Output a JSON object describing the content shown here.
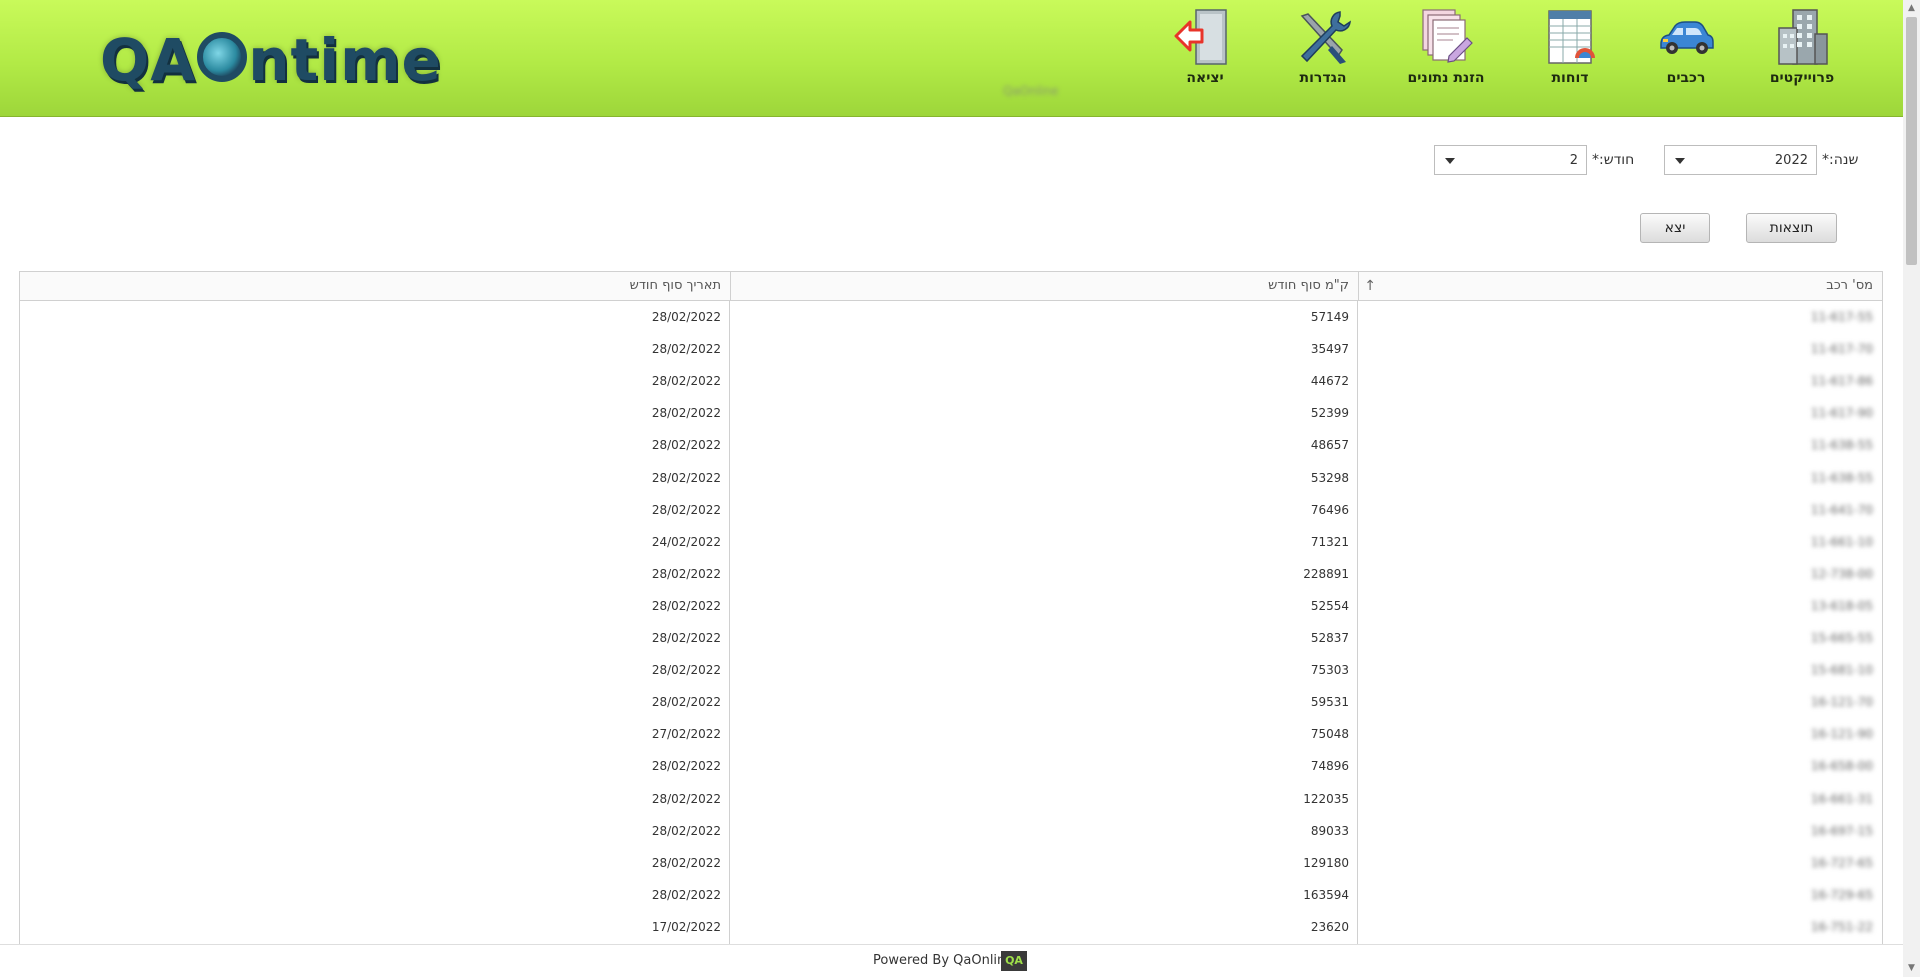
{
  "app": {
    "logo_text": [
      "QA",
      "ntime"
    ],
    "subtitle": "QaOnline"
  },
  "nav": {
    "projects": "פרוייקטים",
    "vehicles": "רכבים",
    "reports": "דוחות",
    "data_entry": "הזנת נתונים",
    "settings": "הגדרות",
    "logout": "יציאה"
  },
  "filters": {
    "year_label": "שנה:*",
    "year_value": "2022",
    "month_label": "חודש:*",
    "month_value": "2"
  },
  "buttons": {
    "results": "תוצאות",
    "export": "יצא"
  },
  "grid": {
    "columns": {
      "vehicle_no": "מס' רכב",
      "km_end": "ק\"מ סוף חודש",
      "date_end": "תאריך סוף חודש"
    },
    "sort_indicator": "↑",
    "rows": [
      {
        "vehicle": "11-617-55",
        "km": "57149",
        "date": "28/02/2022"
      },
      {
        "vehicle": "11-617-70",
        "km": "35497",
        "date": "28/02/2022"
      },
      {
        "vehicle": "11-617-86",
        "km": "44672",
        "date": "28/02/2022"
      },
      {
        "vehicle": "11-617-90",
        "km": "52399",
        "date": "28/02/2022"
      },
      {
        "vehicle": "11-638-55",
        "km": "48657",
        "date": "28/02/2022"
      },
      {
        "vehicle": "11-638-55",
        "km": "53298",
        "date": "28/02/2022"
      },
      {
        "vehicle": "11-641-70",
        "km": "76496",
        "date": "28/02/2022"
      },
      {
        "vehicle": "11-661-10",
        "km": "71321",
        "date": "24/02/2022"
      },
      {
        "vehicle": "12-738-00",
        "km": "228891",
        "date": "28/02/2022"
      },
      {
        "vehicle": "13-618-05",
        "km": "52554",
        "date": "28/02/2022"
      },
      {
        "vehicle": "15-665-55",
        "km": "52837",
        "date": "28/02/2022"
      },
      {
        "vehicle": "15-681-10",
        "km": "75303",
        "date": "28/02/2022"
      },
      {
        "vehicle": "16-121-70",
        "km": "59531",
        "date": "28/02/2022"
      },
      {
        "vehicle": "16-121-90",
        "km": "75048",
        "date": "27/02/2022"
      },
      {
        "vehicle": "16-658-00",
        "km": "74896",
        "date": "28/02/2022"
      },
      {
        "vehicle": "16-661-31",
        "km": "122035",
        "date": "28/02/2022"
      },
      {
        "vehicle": "16-697-15",
        "km": "89033",
        "date": "28/02/2022"
      },
      {
        "vehicle": "16-727-65",
        "km": "129180",
        "date": "28/02/2022"
      },
      {
        "vehicle": "16-729-65",
        "km": "163594",
        "date": "28/02/2022"
      },
      {
        "vehicle": "16-751-22",
        "km": "23620",
        "date": "17/02/2022"
      }
    ]
  },
  "footer": {
    "powered_by": "Powered By QaOnline",
    "logo_mark": "QA"
  },
  "colors": {
    "header_top": "#c9fa5a",
    "header_bottom": "#9dd63a",
    "logo": "#1f4b63"
  }
}
